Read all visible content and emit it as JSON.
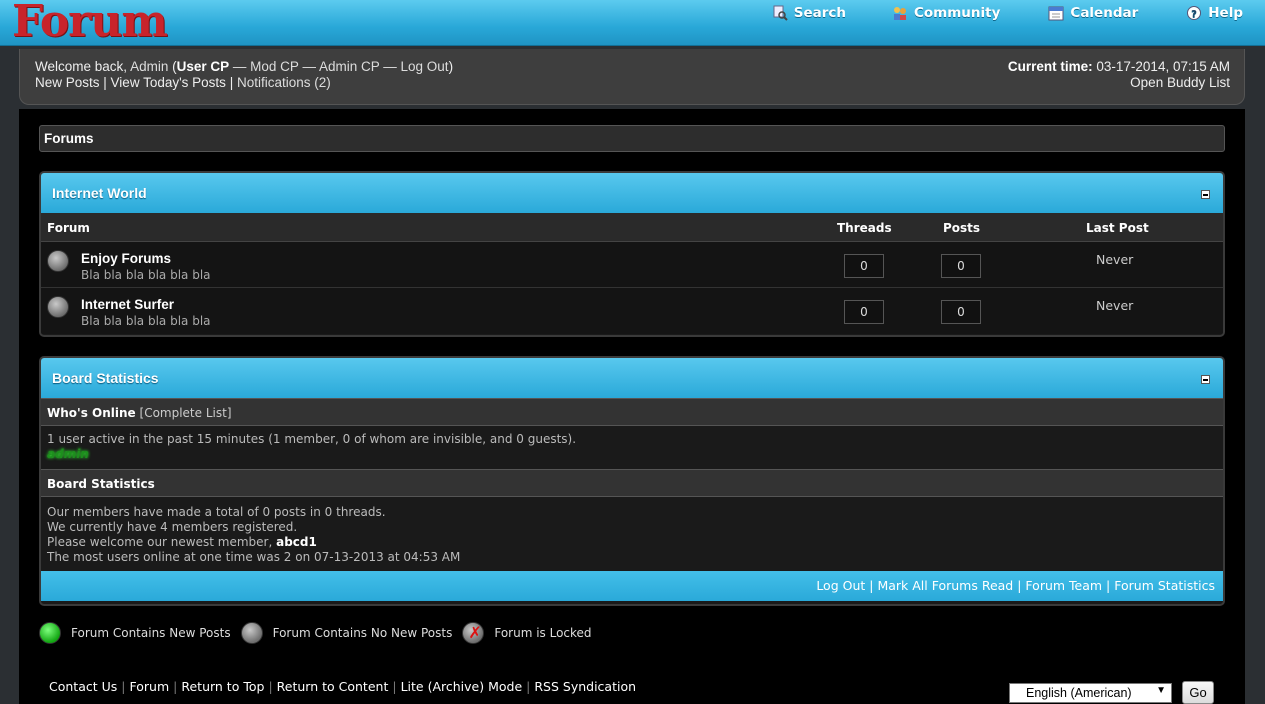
{
  "logo": "Forum",
  "topnav": {
    "search": "Search",
    "community": "Community",
    "calendar": "Calendar",
    "help": "Help"
  },
  "welcome": {
    "welcome_back": "Welcome back,",
    "username": "Admin",
    "user_cp": "User CP",
    "mod_cp": "Mod CP",
    "admin_cp": "Admin CP",
    "logout": "Log Out",
    "new_posts": "New Posts",
    "todays_posts": "View Today's Posts",
    "notifications": "Notifications (2)",
    "current_time_label": "Current time:",
    "current_time": "03-17-2014, 07:15 AM",
    "buddy_list": "Open Buddy List"
  },
  "breadcrumb": "Forums",
  "category": {
    "title": "Internet World",
    "columns": {
      "forum": "Forum",
      "threads": "Threads",
      "posts": "Posts",
      "last_post": "Last Post"
    },
    "forums": [
      {
        "name": "Enjoy Forums",
        "desc": "Bla bla bla bla bla bla",
        "threads": "0",
        "posts": "0",
        "last_post": "Never"
      },
      {
        "name": "Internet Surfer",
        "desc": "Bla bla bla bla bla bla",
        "threads": "0",
        "posts": "0",
        "last_post": "Never"
      }
    ]
  },
  "stats": {
    "title": "Board Statistics",
    "whos_online": "Who's Online",
    "complete_list": "Complete List",
    "active_text": "1 user active in the past 15 minutes (1 member, 0 of whom are invisible, and 0 guests).",
    "online_user": "admin",
    "board_stats": "Board Statistics",
    "line1": "Our members have made a total of 0 posts in 0 threads.",
    "line2": "We currently have 4 members registered.",
    "line3_prefix": "Please welcome our newest member,",
    "newest_member": "abcd1",
    "line4": "The most users online at one time was 2 on 07-13-2013 at 04:53 AM",
    "footer_links": [
      "Log Out",
      "Mark All Forums Read",
      "Forum Team",
      "Forum Statistics"
    ]
  },
  "legend": {
    "new": "Forum Contains New Posts",
    "no_new": "Forum Contains No New Posts",
    "locked": "Forum is Locked"
  },
  "bottom_links": [
    "Contact Us",
    "Forum",
    "Return to Top",
    "Return to Content",
    "Lite (Archive) Mode",
    "RSS Syndication"
  ],
  "language": {
    "selected": "English (American)",
    "go": "Go"
  },
  "colors": {
    "accent": "#2aa9d9",
    "logo": "#c8242b",
    "background": "#000000"
  }
}
